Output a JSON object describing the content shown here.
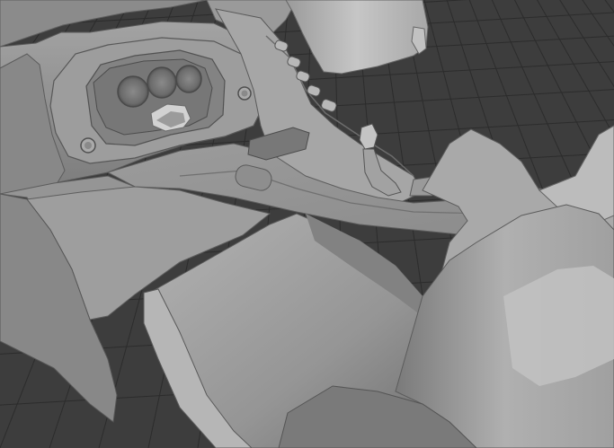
{
  "viewport": {
    "background_color": "#3d3d3d",
    "grid_color": "#2c2c2c",
    "axis_y_color": "#6fa41f",
    "model_base_color": "#8f8f8f",
    "model_highlight_color": "#b9b9b9",
    "model_shadow_color": "#5e5e5e",
    "shading_mode": "solid",
    "grid_visible": true,
    "subject": "car-interior-mesh"
  }
}
